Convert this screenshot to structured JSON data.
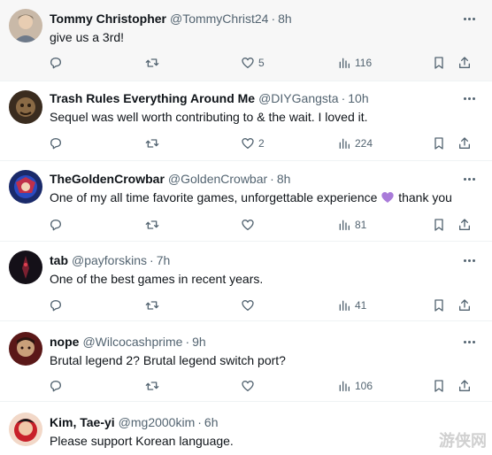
{
  "tweets": [
    {
      "name": "Tommy Christopher",
      "handle": "@TommyChrist24",
      "dot": "·",
      "time": "8h",
      "text": "give us a 3rd!",
      "likes": "5",
      "views": "116",
      "replies": "",
      "retweets": "",
      "avatar_icon": "avatar-photo"
    },
    {
      "name": "Trash Rules Everything Around Me",
      "handle": "@DIYGangsta",
      "dot": "·",
      "time": "10h",
      "text": "Sequel was well worth contributing to & the wait. I loved it.",
      "likes": "2",
      "views": "224",
      "replies": "",
      "retweets": "",
      "avatar_icon": "avatar-photo"
    },
    {
      "name": "TheGoldenCrowbar",
      "handle": "@GoldenCrowbar",
      "dot": "·",
      "time": "8h",
      "text_before": "One of my all time favorite games, unforgettable experience",
      "text_after": "thank you",
      "emoji": "purple-heart-emoji",
      "likes": "",
      "views": "81",
      "replies": "",
      "retweets": "",
      "avatar_icon": "avatar-photo"
    },
    {
      "name": "tab",
      "handle": "@payforskins",
      "dot": "·",
      "time": "7h",
      "text": "One of the best games in recent years.",
      "likes": "",
      "views": "41",
      "replies": "",
      "retweets": "",
      "avatar_icon": "avatar-photo"
    },
    {
      "name": "nope",
      "handle": "@Wilcocashprime",
      "dot": "·",
      "time": "9h",
      "text": "Brutal legend 2? Brutal legend switch port?",
      "likes": "",
      "views": "106",
      "replies": "",
      "retweets": "",
      "avatar_icon": "avatar-photo"
    },
    {
      "name": "Kim, Tae-yi",
      "handle": "@mg2000kim",
      "dot": "·",
      "time": "6h",
      "text": "Please support Korean language.",
      "avatar_icon": "avatar-photo"
    }
  ],
  "icons": {
    "reply": "reply-icon",
    "retweet": "retweet-icon",
    "like": "heart-icon",
    "views": "views-icon",
    "bookmark": "bookmark-icon",
    "share": "share-icon",
    "more": "more-icon"
  },
  "colors": {
    "text": "#0f1419",
    "secondary": "#536471",
    "divider": "#eff3f4",
    "highlight_bg": "#f7f7f7",
    "emoji_heart": "#a97bd9"
  },
  "watermark": "游侠网"
}
